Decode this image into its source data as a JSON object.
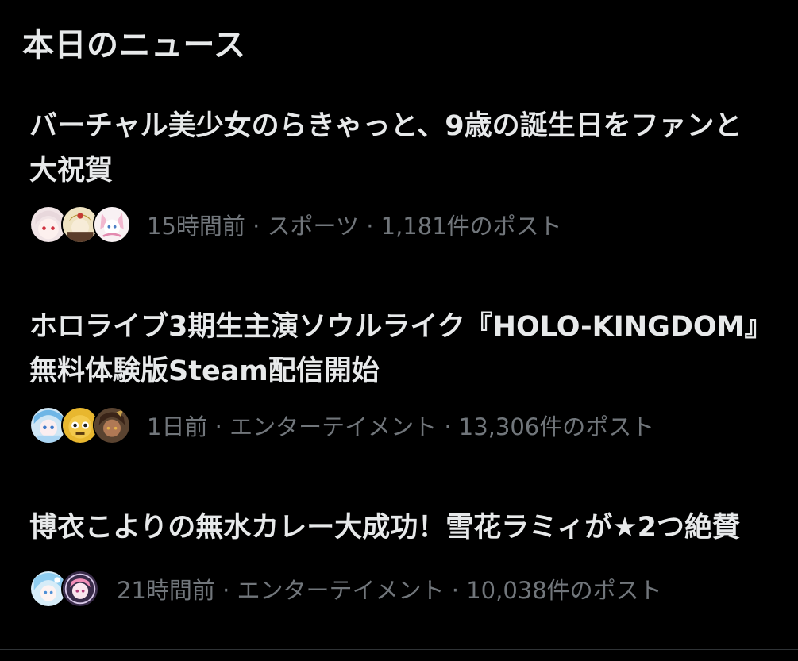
{
  "section": {
    "title": "本日のニュース"
  },
  "news": [
    {
      "headline": "バーチャル美少女のらきゃっと、9歳の誕生日をファンと大祝賀",
      "meta": "15時間前 · スポーツ · 1,181件のポスト"
    },
    {
      "headline": "ホロライブ3期生主演ソウルライク『HOLO-KINGDOM』無料体験版Steam配信開始",
      "meta": "1日前 · エンターテイメント · 13,306件のポスト"
    },
    {
      "headline": "博衣こよりの無水カレー大成功！雪花ラミィが★2つ絶賛",
      "meta": "21時間前 · エンターテイメント · 10,038件のポスト"
    }
  ],
  "colors": {
    "background": "#000000",
    "primary_text": "#e7e9ea",
    "secondary_text": "#71767b"
  }
}
